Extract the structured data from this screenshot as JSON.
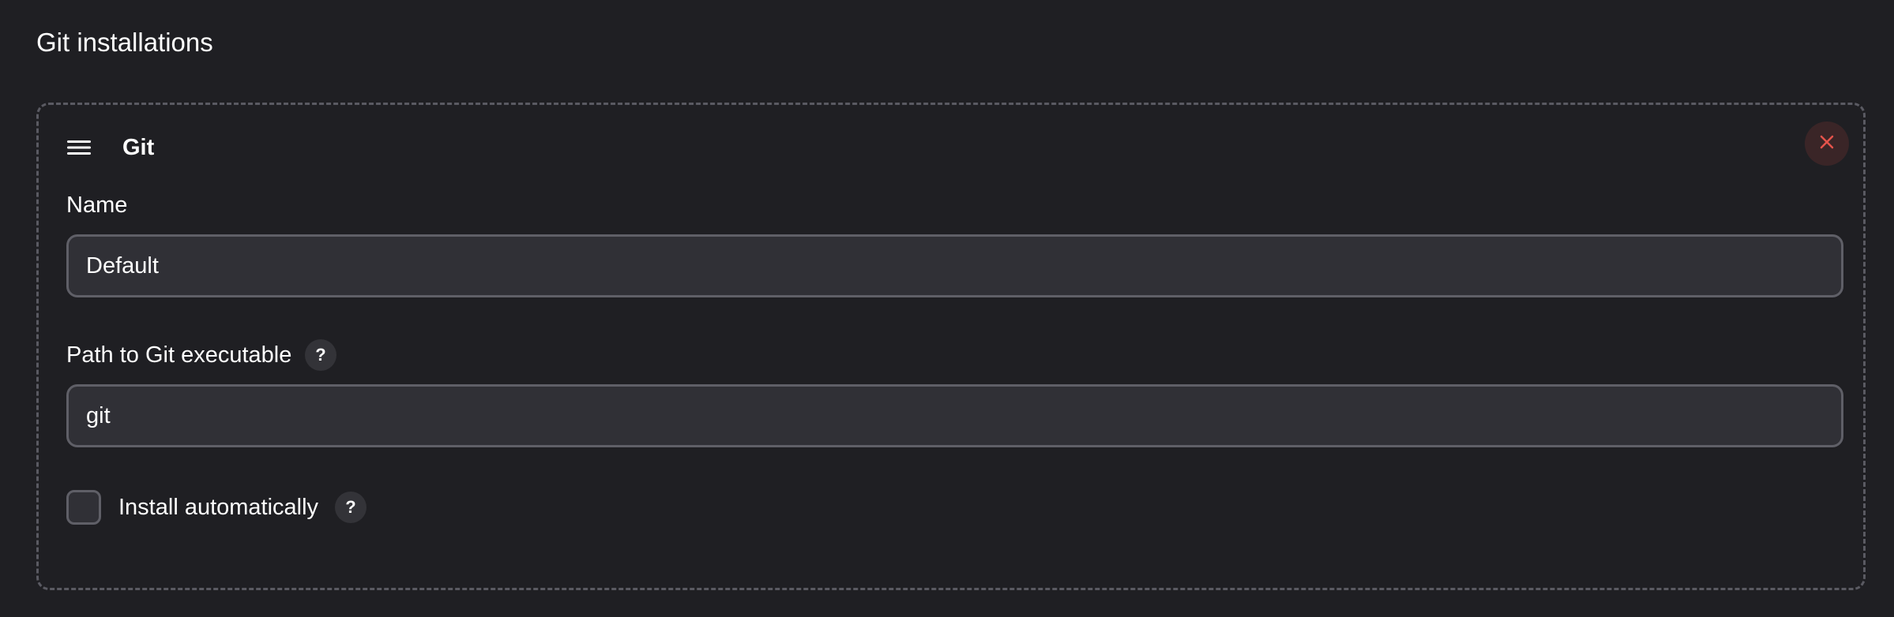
{
  "section": {
    "title": "Git installations"
  },
  "tool": {
    "title": "Git",
    "drag_icon": "hamburger-icon",
    "remove_icon": "close-icon",
    "fields": {
      "name": {
        "label": "Name",
        "value": "Default"
      },
      "path": {
        "label": "Path to Git executable",
        "value": "git",
        "help": "?"
      },
      "install_automatically": {
        "label": "Install automatically",
        "checked": false,
        "help": "?"
      }
    }
  },
  "colors": {
    "background": "#1f1f23",
    "input_background": "#303036",
    "border": "#5f5f67",
    "danger": "#e5534b"
  }
}
